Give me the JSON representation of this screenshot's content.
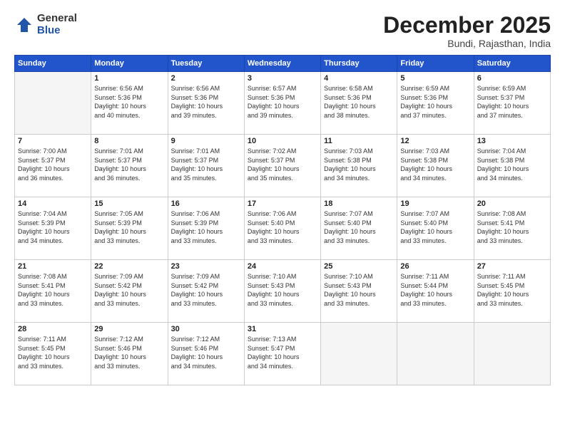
{
  "logo": {
    "general": "General",
    "blue": "Blue"
  },
  "header": {
    "month_year": "December 2025",
    "location": "Bundi, Rajasthan, India"
  },
  "columns": [
    "Sunday",
    "Monday",
    "Tuesday",
    "Wednesday",
    "Thursday",
    "Friday",
    "Saturday"
  ],
  "weeks": [
    [
      {
        "day": "",
        "info": ""
      },
      {
        "day": "1",
        "info": "Sunrise: 6:56 AM\nSunset: 5:36 PM\nDaylight: 10 hours\nand 40 minutes."
      },
      {
        "day": "2",
        "info": "Sunrise: 6:56 AM\nSunset: 5:36 PM\nDaylight: 10 hours\nand 39 minutes."
      },
      {
        "day": "3",
        "info": "Sunrise: 6:57 AM\nSunset: 5:36 PM\nDaylight: 10 hours\nand 39 minutes."
      },
      {
        "day": "4",
        "info": "Sunrise: 6:58 AM\nSunset: 5:36 PM\nDaylight: 10 hours\nand 38 minutes."
      },
      {
        "day": "5",
        "info": "Sunrise: 6:59 AM\nSunset: 5:36 PM\nDaylight: 10 hours\nand 37 minutes."
      },
      {
        "day": "6",
        "info": "Sunrise: 6:59 AM\nSunset: 5:37 PM\nDaylight: 10 hours\nand 37 minutes."
      }
    ],
    [
      {
        "day": "7",
        "info": "Sunrise: 7:00 AM\nSunset: 5:37 PM\nDaylight: 10 hours\nand 36 minutes."
      },
      {
        "day": "8",
        "info": "Sunrise: 7:01 AM\nSunset: 5:37 PM\nDaylight: 10 hours\nand 36 minutes."
      },
      {
        "day": "9",
        "info": "Sunrise: 7:01 AM\nSunset: 5:37 PM\nDaylight: 10 hours\nand 35 minutes."
      },
      {
        "day": "10",
        "info": "Sunrise: 7:02 AM\nSunset: 5:37 PM\nDaylight: 10 hours\nand 35 minutes."
      },
      {
        "day": "11",
        "info": "Sunrise: 7:03 AM\nSunset: 5:38 PM\nDaylight: 10 hours\nand 34 minutes."
      },
      {
        "day": "12",
        "info": "Sunrise: 7:03 AM\nSunset: 5:38 PM\nDaylight: 10 hours\nand 34 minutes."
      },
      {
        "day": "13",
        "info": "Sunrise: 7:04 AM\nSunset: 5:38 PM\nDaylight: 10 hours\nand 34 minutes."
      }
    ],
    [
      {
        "day": "14",
        "info": "Sunrise: 7:04 AM\nSunset: 5:39 PM\nDaylight: 10 hours\nand 34 minutes."
      },
      {
        "day": "15",
        "info": "Sunrise: 7:05 AM\nSunset: 5:39 PM\nDaylight: 10 hours\nand 33 minutes."
      },
      {
        "day": "16",
        "info": "Sunrise: 7:06 AM\nSunset: 5:39 PM\nDaylight: 10 hours\nand 33 minutes."
      },
      {
        "day": "17",
        "info": "Sunrise: 7:06 AM\nSunset: 5:40 PM\nDaylight: 10 hours\nand 33 minutes."
      },
      {
        "day": "18",
        "info": "Sunrise: 7:07 AM\nSunset: 5:40 PM\nDaylight: 10 hours\nand 33 minutes."
      },
      {
        "day": "19",
        "info": "Sunrise: 7:07 AM\nSunset: 5:40 PM\nDaylight: 10 hours\nand 33 minutes."
      },
      {
        "day": "20",
        "info": "Sunrise: 7:08 AM\nSunset: 5:41 PM\nDaylight: 10 hours\nand 33 minutes."
      }
    ],
    [
      {
        "day": "21",
        "info": "Sunrise: 7:08 AM\nSunset: 5:41 PM\nDaylight: 10 hours\nand 33 minutes."
      },
      {
        "day": "22",
        "info": "Sunrise: 7:09 AM\nSunset: 5:42 PM\nDaylight: 10 hours\nand 33 minutes."
      },
      {
        "day": "23",
        "info": "Sunrise: 7:09 AM\nSunset: 5:42 PM\nDaylight: 10 hours\nand 33 minutes."
      },
      {
        "day": "24",
        "info": "Sunrise: 7:10 AM\nSunset: 5:43 PM\nDaylight: 10 hours\nand 33 minutes."
      },
      {
        "day": "25",
        "info": "Sunrise: 7:10 AM\nSunset: 5:43 PM\nDaylight: 10 hours\nand 33 minutes."
      },
      {
        "day": "26",
        "info": "Sunrise: 7:11 AM\nSunset: 5:44 PM\nDaylight: 10 hours\nand 33 minutes."
      },
      {
        "day": "27",
        "info": "Sunrise: 7:11 AM\nSunset: 5:45 PM\nDaylight: 10 hours\nand 33 minutes."
      }
    ],
    [
      {
        "day": "28",
        "info": "Sunrise: 7:11 AM\nSunset: 5:45 PM\nDaylight: 10 hours\nand 33 minutes."
      },
      {
        "day": "29",
        "info": "Sunrise: 7:12 AM\nSunset: 5:46 PM\nDaylight: 10 hours\nand 33 minutes."
      },
      {
        "day": "30",
        "info": "Sunrise: 7:12 AM\nSunset: 5:46 PM\nDaylight: 10 hours\nand 34 minutes."
      },
      {
        "day": "31",
        "info": "Sunrise: 7:13 AM\nSunset: 5:47 PM\nDaylight: 10 hours\nand 34 minutes."
      },
      {
        "day": "",
        "info": ""
      },
      {
        "day": "",
        "info": ""
      },
      {
        "day": "",
        "info": ""
      }
    ]
  ]
}
